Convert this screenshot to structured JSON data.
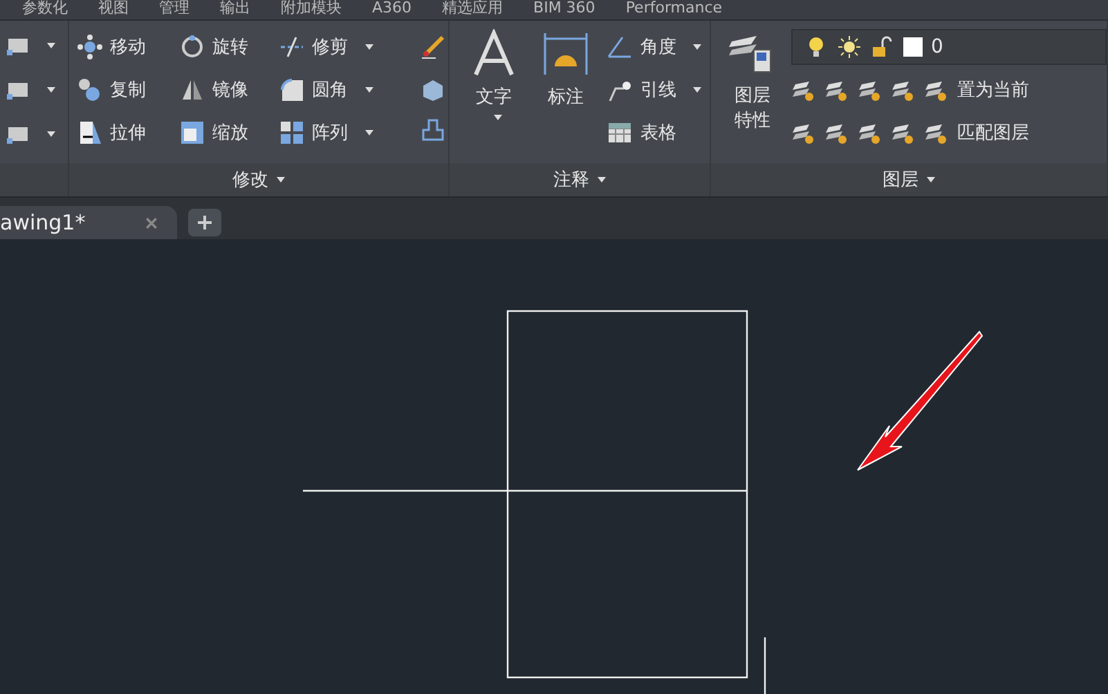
{
  "ribbon_tabs": [
    {
      "label": "参数化",
      "selected": false
    },
    {
      "label": "视图",
      "selected": false
    },
    {
      "label": "管理",
      "selected": false
    },
    {
      "label": "输出",
      "selected": false
    },
    {
      "label": "附加模块",
      "selected": false
    },
    {
      "label": "A360",
      "selected": false
    },
    {
      "label": "精选应用",
      "selected": false
    },
    {
      "label": "BIM 360",
      "selected": false
    },
    {
      "label": "Performance",
      "selected": false
    }
  ],
  "modify_panel": {
    "title": "修改",
    "tools": [
      {
        "label": "移动",
        "dropdown": false
      },
      {
        "label": "旋转",
        "dropdown": false
      },
      {
        "label": "修剪",
        "dropdown": true
      },
      {
        "label": "复制",
        "dropdown": false
      },
      {
        "label": "镜像",
        "dropdown": false
      },
      {
        "label": "圆角",
        "dropdown": true
      },
      {
        "label": "拉伸",
        "dropdown": false
      },
      {
        "label": "缩放",
        "dropdown": false
      },
      {
        "label": "阵列",
        "dropdown": true
      }
    ]
  },
  "annotation_panel": {
    "title": "注释",
    "large_tools": [
      {
        "label": "文字",
        "dropdown": true
      },
      {
        "label": "标注",
        "dropdown": false
      }
    ],
    "tools": [
      {
        "label": "角度",
        "dropdown": true
      },
      {
        "label": "引线",
        "dropdown": true
      },
      {
        "label": "表格",
        "dropdown": false
      }
    ]
  },
  "layers_panel": {
    "title": "图层",
    "properties_button": "图层特性",
    "layer_value": "0",
    "tools": [
      {
        "label": "置为当前"
      },
      {
        "label": "匹配图层"
      }
    ]
  },
  "document_tabs": [
    {
      "label": "awing1*",
      "selected": true
    }
  ]
}
